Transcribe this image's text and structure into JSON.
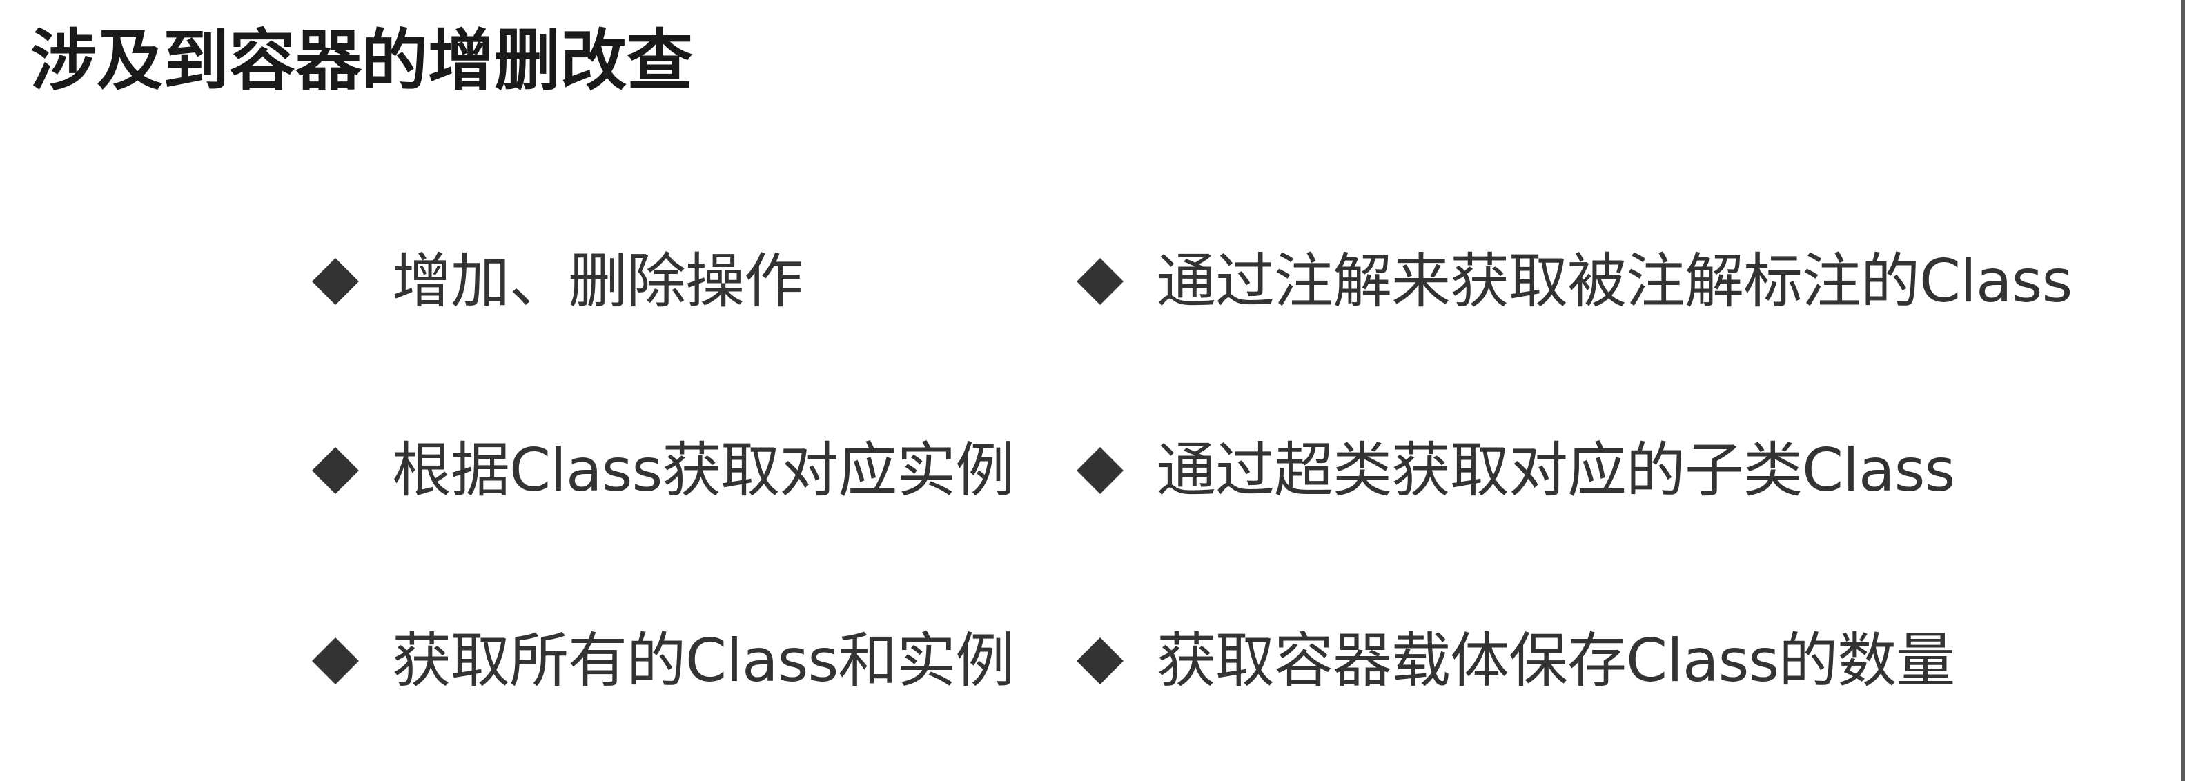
{
  "title": "涉及到容器的增删改查",
  "bullets": {
    "left": [
      "增加、删除操作",
      "根据Class获取对应实例",
      "获取所有的Class和实例"
    ],
    "right": [
      "通过注解来获取被注解标注的Class",
      "通过超类获取对应的子类Class",
      "获取容器载体保存Class的数量"
    ]
  },
  "colors": {
    "text": "#333333",
    "title": "#1a1a1a",
    "background": "#ffffff"
  }
}
